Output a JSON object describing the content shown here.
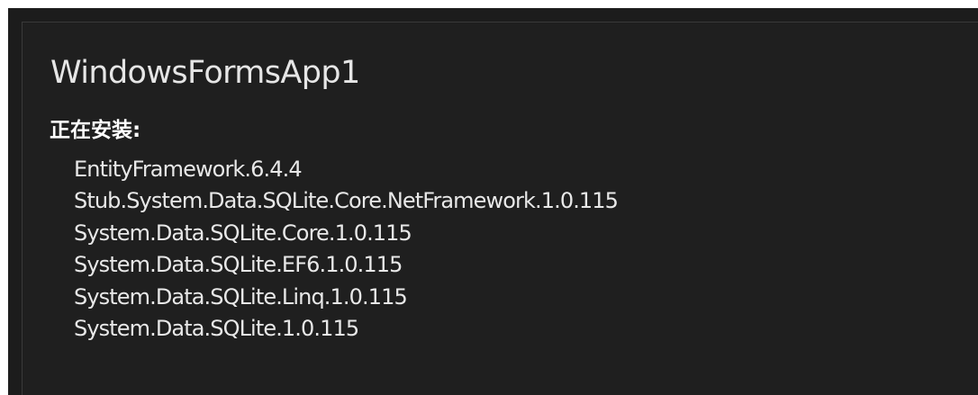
{
  "window": {
    "title": "WindowsFormsApp1"
  },
  "install": {
    "label": "正在安装:",
    "packages": [
      "EntityFramework.6.4.4",
      "Stub.System.Data.SQLite.Core.NetFramework.1.0.115",
      "System.Data.SQLite.Core.1.0.115",
      "System.Data.SQLite.EF6.1.0.115",
      "System.Data.SQLite.Linq.1.0.115",
      "System.Data.SQLite.1.0.115"
    ]
  }
}
